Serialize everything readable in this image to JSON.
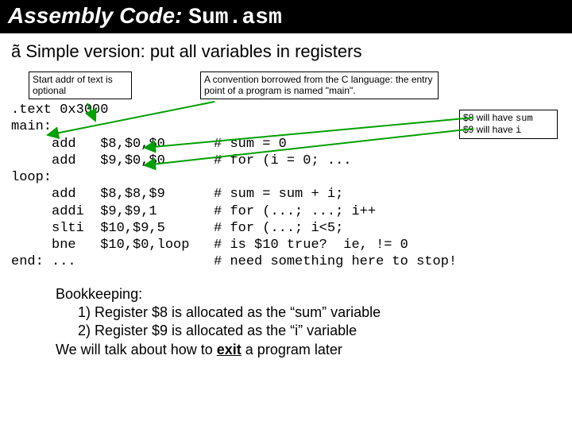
{
  "title": {
    "prefix": "Assembly Code:  ",
    "filename": "Sum.asm"
  },
  "bullet_marker": "ã",
  "bullet_text": "Simple version:  put all variables in registers",
  "callouts": {
    "start_addr": "Start addr of text is optional",
    "convention": "A convention borrowed from the C language:  the entry point of a program is named \"main\".",
    "regs_line1": "$8 will have ",
    "regs_sum": "sum",
    "regs_line2": "$9 will have ",
    "regs_i": "i"
  },
  "code": ".text 0x3000\nmain:\n     add   $8,$0,$0      # sum = 0\n     add   $9,$0,$0      # for (i = 0; ...\nloop:\n     add   $8,$8,$9      # sum = sum + i;\n     addi  $9,$9,1       # for (...; ...; i++\n     slti  $10,$9,5      # for (...; i<5;\n     bne   $10,$0,loop   # is $10 true?  ie, != 0\nend: ...                 # need something here to stop!",
  "bookkeeping": {
    "head": "Bookkeeping:",
    "l1": "1) Register $8 is allocated as the “sum” variable",
    "l2": "2) Register $9 is allocated as the “i” variable",
    "exit_pre": "We will talk about how to ",
    "exit_word": "exit",
    "exit_post": " a program later"
  }
}
